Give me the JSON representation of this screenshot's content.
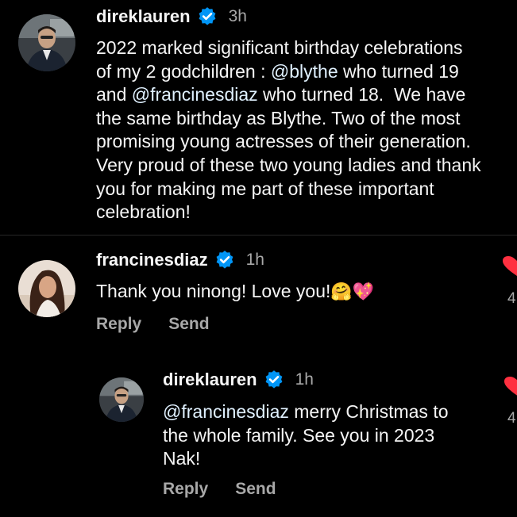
{
  "comments": [
    {
      "username": "direklauren",
      "time": "3h",
      "text_lines": [
        "2022 marked significant birthday celebrations",
        "of my 2 godchildren : ",
        "and ",
        "the same birthday as Blythe. Two of the most",
        "promising young actresses of their generation.",
        "Very proud of these two young ladies and thank",
        "you for making me part of these important",
        "celebration!"
      ],
      "mention_1": "@blythe",
      "after_mention_1": " who turned 19",
      "mention_2": "@francinesdiaz",
      "after_mention_2": " who turned 18.  We have"
    },
    {
      "username": "francinesdiaz",
      "time": "1h",
      "text": "Thank you ninong! Love you!",
      "emojis": "🤗💖",
      "reply_label": "Reply",
      "send_label": "Send",
      "like_count": "4"
    },
    {
      "username": "direklauren",
      "time": "1h",
      "mention": "@francinesdiaz",
      "text_line1_rest": " merry Christmas to",
      "text_line2": "the whole family. See you in 2023",
      "text_line3": "Nak!",
      "reply_label": "Reply",
      "send_label": "Send",
      "like_count": "4"
    }
  ],
  "colors": {
    "background": "#000000",
    "primary_text": "#f5f5f5",
    "secondary_text": "#a8a8a8",
    "verified_badge": "#0095f6",
    "heart": "#ff3040",
    "divider": "#262626"
  }
}
